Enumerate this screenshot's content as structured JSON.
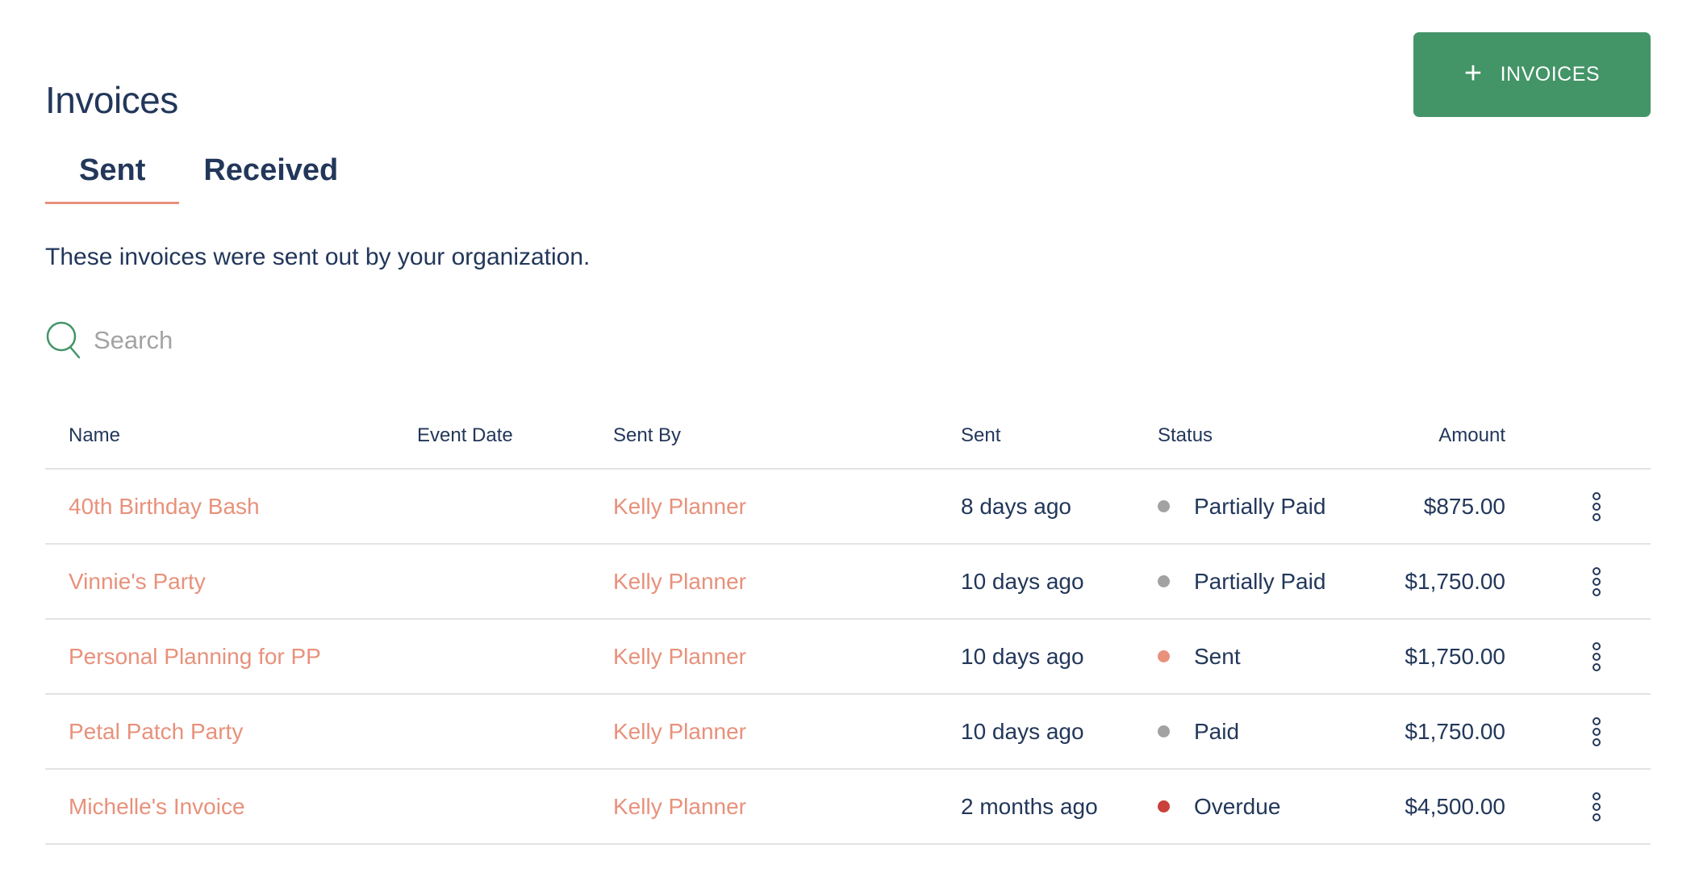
{
  "page": {
    "title": "Invoices"
  },
  "add_button": {
    "label": "INVOICES",
    "icon": "plus-icon",
    "color": "#439467"
  },
  "tabs": [
    {
      "label": "Sent",
      "active": true
    },
    {
      "label": "Received",
      "active": false
    }
  ],
  "description": "These invoices were sent out by your organization.",
  "search": {
    "placeholder": "Search",
    "value": ""
  },
  "table": {
    "columns": [
      "Name",
      "Event Date",
      "Sent By",
      "Sent",
      "Status",
      "Amount"
    ],
    "rows": [
      {
        "name": "40th Birthday Bash",
        "event_date": "",
        "sent_by": "Kelly Planner",
        "sent": "8 days ago",
        "status": "Partially Paid",
        "status_color": "#a2a2a2",
        "amount": "$875.00"
      },
      {
        "name": "Vinnie's Party",
        "event_date": "",
        "sent_by": "Kelly Planner",
        "sent": "10 days ago",
        "status": "Partially Paid",
        "status_color": "#a2a2a2",
        "amount": "$1,750.00"
      },
      {
        "name": "Personal Planning for PP",
        "event_date": "",
        "sent_by": "Kelly Planner",
        "sent": "10 days ago",
        "status": "Sent",
        "status_color": "#e8917b",
        "amount": "$1,750.00"
      },
      {
        "name": "Petal Patch Party",
        "event_date": "",
        "sent_by": "Kelly Planner",
        "sent": "10 days ago",
        "status": "Paid",
        "status_color": "#a2a2a2",
        "amount": "$1,750.00"
      },
      {
        "name": "Michelle's Invoice",
        "event_date": "",
        "sent_by": "Kelly Planner",
        "sent": "2 months ago",
        "status": "Overdue",
        "status_color": "#c8413a",
        "amount": "$4,500.00"
      }
    ]
  },
  "colors": {
    "text": "#22375a",
    "link": "#e8917b",
    "accent": "#439467",
    "divider": "#e3e3e3"
  }
}
